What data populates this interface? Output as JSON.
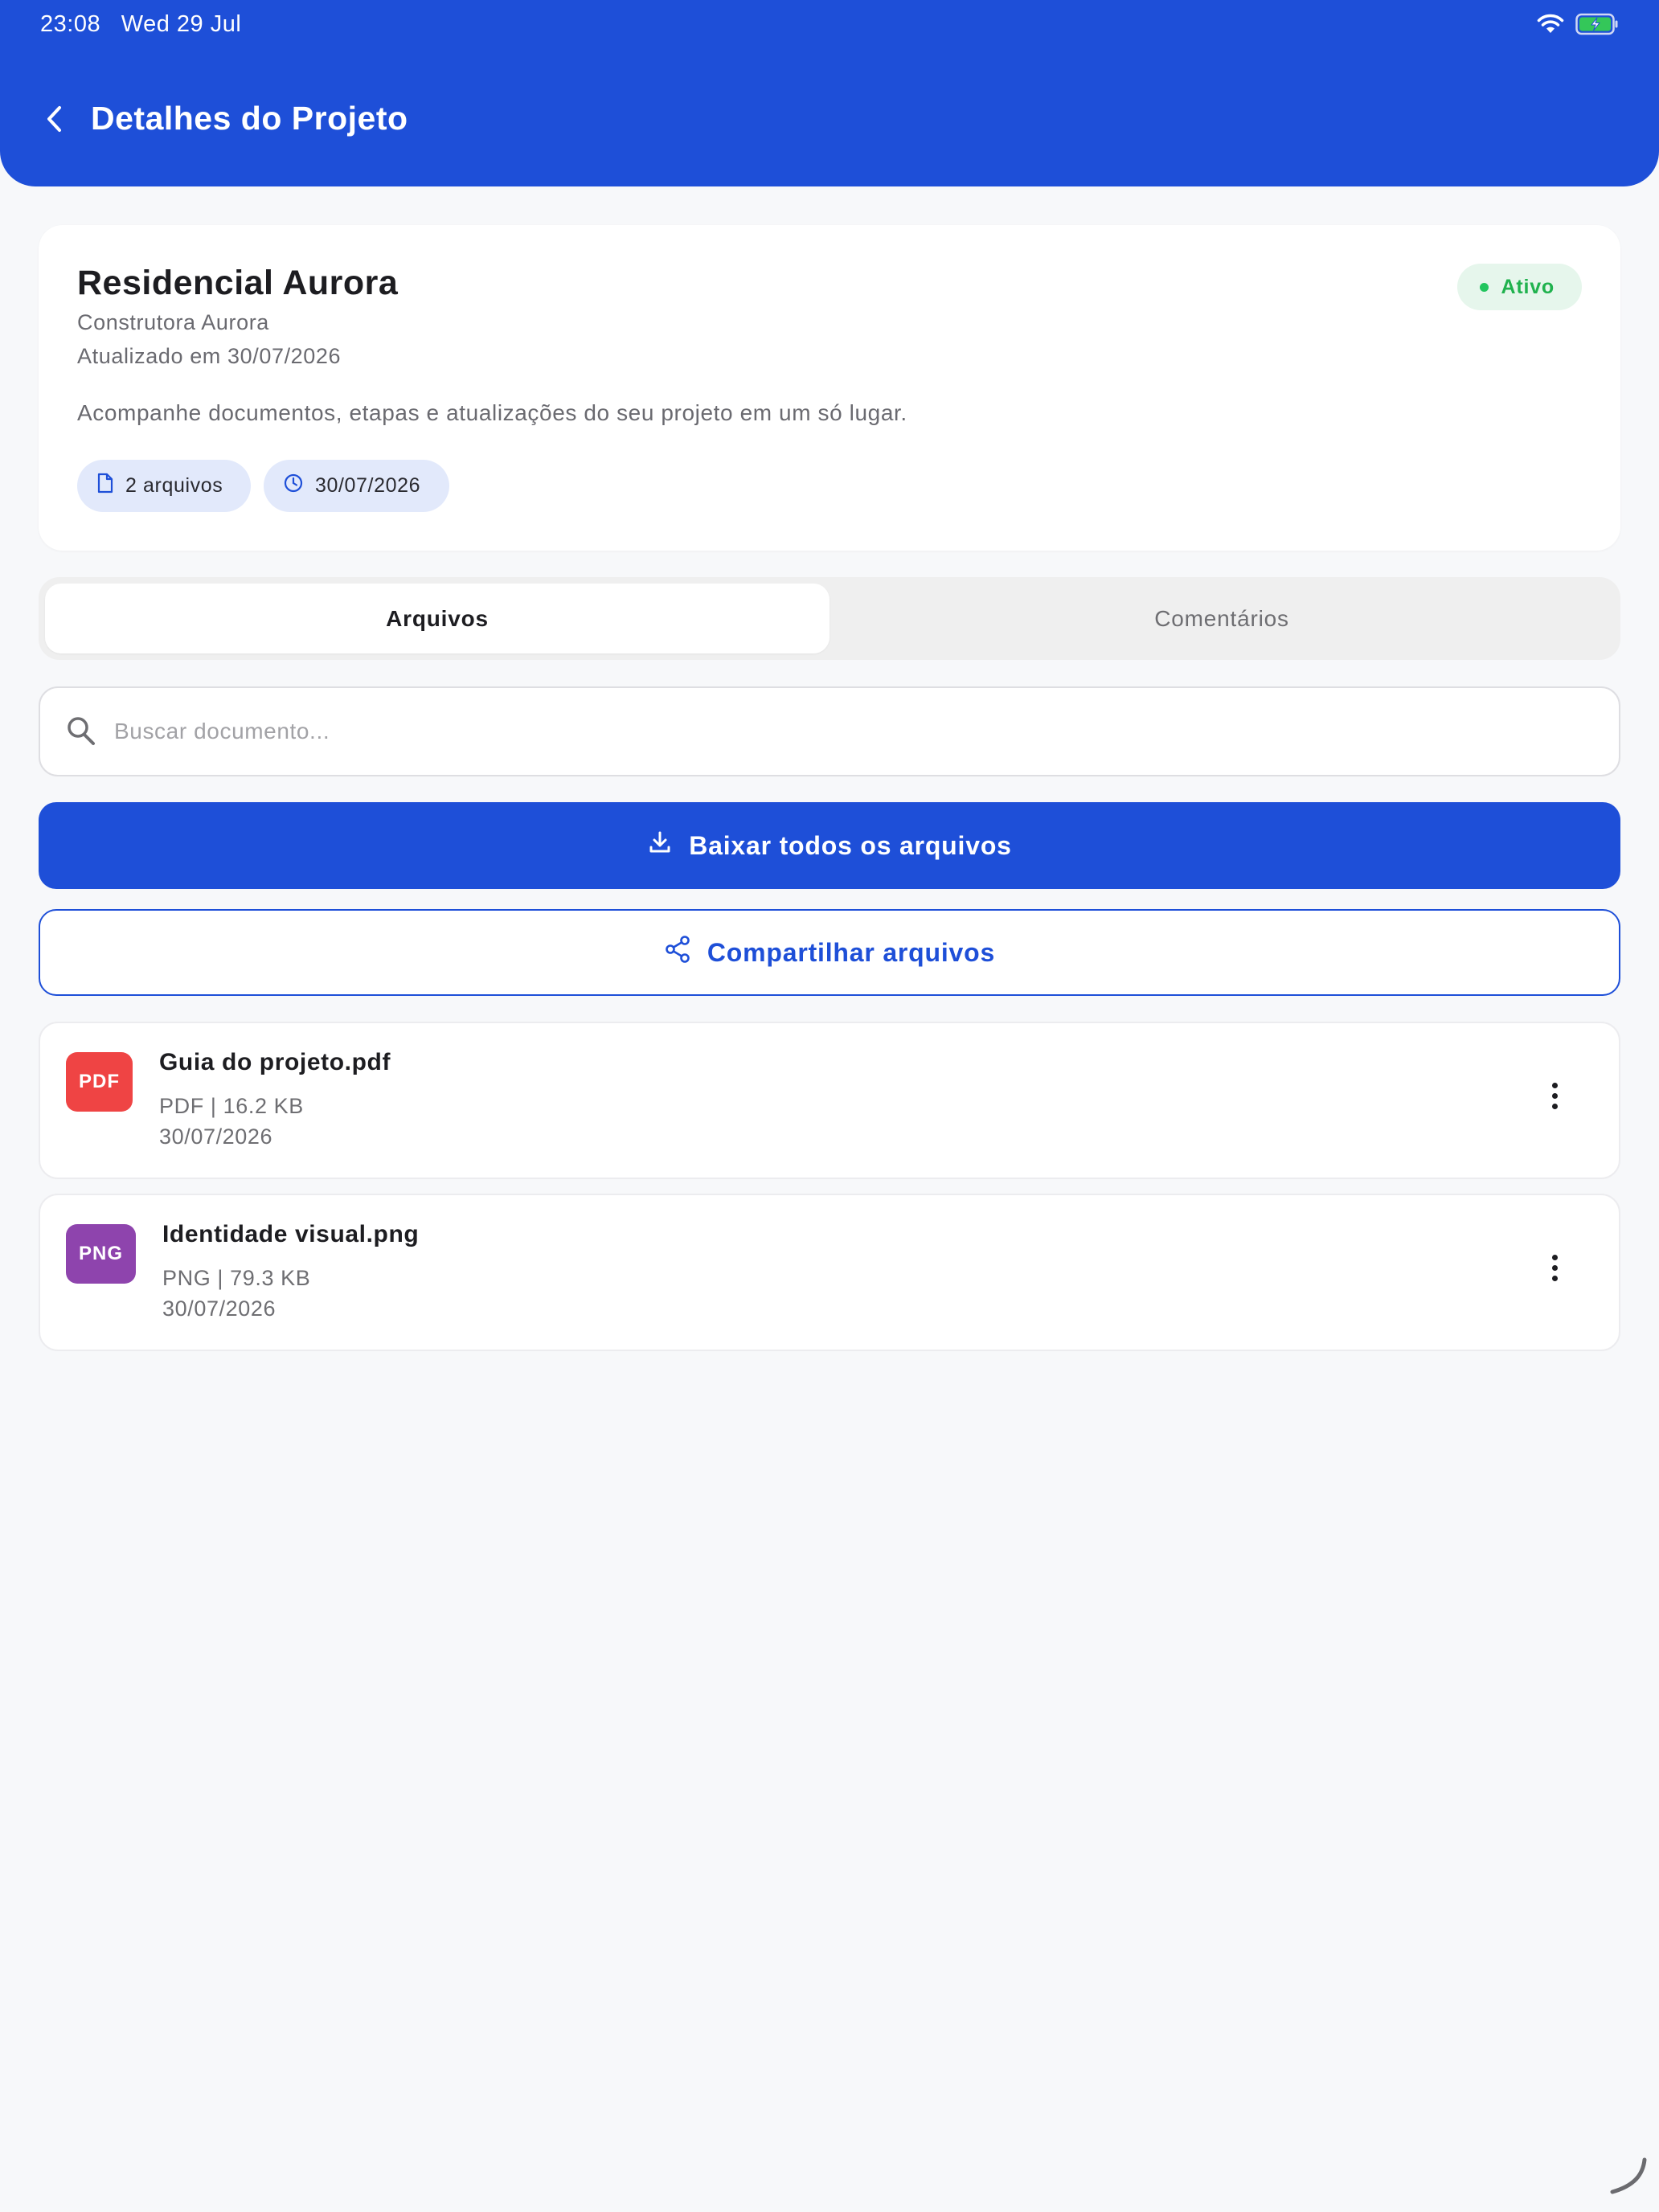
{
  "status_bar": {
    "time": "23:08",
    "date": "Wed 29 Jul"
  },
  "header": {
    "title": "Detalhes do Projeto",
    "color": "#1e4fd8"
  },
  "project": {
    "name": "Residencial Aurora",
    "company": "Construtora Aurora",
    "updated": "Atualizado em 30/07/2026",
    "description": "Acompanhe documentos, etapas e atualizações do seu projeto em um só lugar.",
    "status": "Ativo",
    "status_color": "#20b24e",
    "chips": {
      "files": "2 arquivos",
      "date": "30/07/2026"
    }
  },
  "tabs": [
    {
      "label": "Arquivos",
      "active": true
    },
    {
      "label": "Comentários",
      "active": false
    }
  ],
  "search": {
    "placeholder": "Buscar documento...",
    "value": ""
  },
  "actions": {
    "download_all": "Baixar todos os arquivos",
    "share": "Compartilhar arquivos"
  },
  "files": [
    {
      "type": "PDF",
      "type_color": "#ef4444",
      "name": "Guia do projeto.pdf",
      "meta": "PDF | 16.2 KB",
      "date": "30/07/2026"
    },
    {
      "type": "PNG",
      "type_color": "#8e44ad",
      "name": "Identidade visual.png",
      "meta": "PNG | 79.3 KB",
      "date": "30/07/2026"
    }
  ],
  "icons": {
    "back": "chevron-left-icon",
    "file": "document-icon",
    "clock": "clock-icon",
    "search": "search-icon",
    "download": "download-icon",
    "share": "share-icon",
    "more": "more-vertical-icon",
    "wifi": "wifi-icon",
    "battery": "battery-charging-icon"
  }
}
